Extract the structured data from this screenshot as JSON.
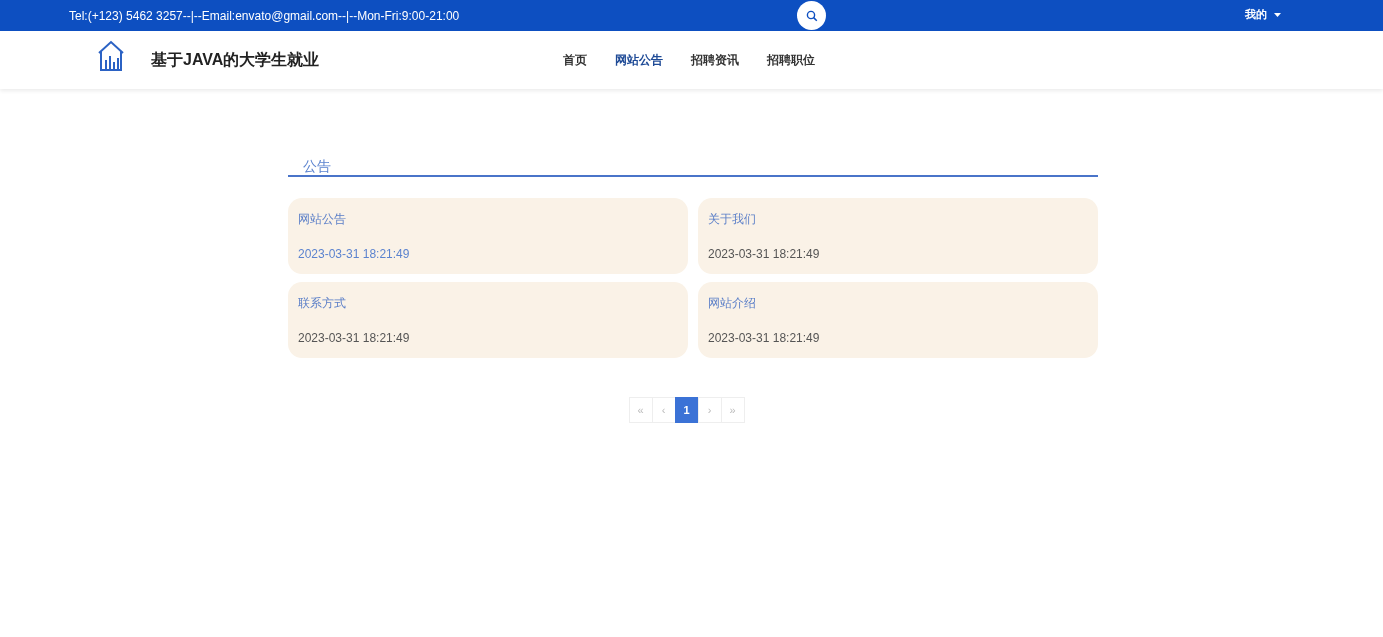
{
  "top_bar": {
    "contact": "Tel:(+123) 5462 3257--|--Email:envato@gmail.com--|--Mon-Fri:9:00-21:00",
    "user_menu": "我的"
  },
  "header": {
    "site_title": "基于JAVA的大学生就业",
    "nav": [
      {
        "label": "首页",
        "selected": false
      },
      {
        "label": "网站公告",
        "selected": true
      },
      {
        "label": "招聘资讯",
        "selected": false
      },
      {
        "label": "招聘职位",
        "selected": false
      }
    ]
  },
  "section": {
    "title": "公告",
    "cards": [
      {
        "title": "网站公告",
        "date": "2023-03-31 18:21:49",
        "hovered": true
      },
      {
        "title": "关于我们",
        "date": "2023-03-31 18:21:49",
        "hovered": false
      },
      {
        "title": "联系方式",
        "date": "2023-03-31 18:21:49",
        "hovered": false
      },
      {
        "title": "网站介绍",
        "date": "2023-03-31 18:21:49",
        "hovered": false
      }
    ]
  },
  "pagination": [
    {
      "label": "«",
      "selected": false
    },
    {
      "label": "‹",
      "selected": false
    },
    {
      "label": "1",
      "selected": true
    },
    {
      "label": "›",
      "selected": false
    },
    {
      "label": "»",
      "selected": false
    }
  ]
}
